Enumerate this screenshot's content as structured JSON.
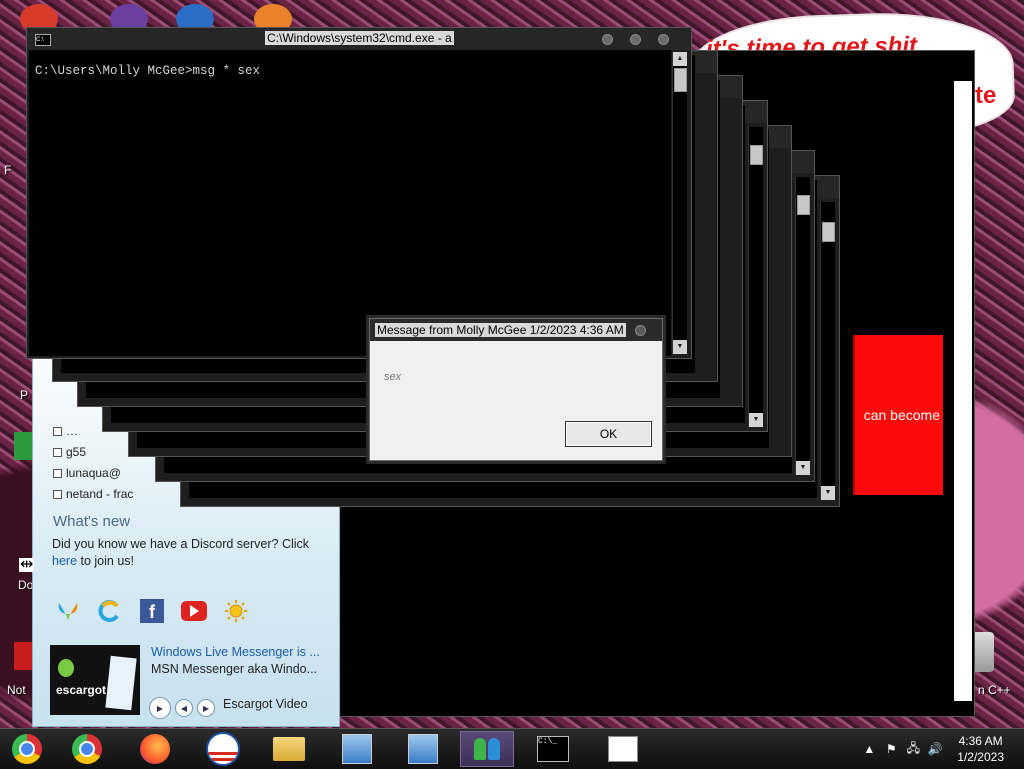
{
  "wallpaper": {
    "bubble_line1": "it's time to get shit",
    "bubble_line2": "te"
  },
  "desktop_labels": {
    "do": "Do",
    "not": "Not",
    "cpp": "n C++",
    "p": "P",
    "f": "F"
  },
  "red_panel": {
    "text": "can become"
  },
  "cmd": {
    "title": "C:\\Windows\\system32\\cmd.exe - a",
    "prompt": "C:\\Users\\Molly McGee>msg * sex"
  },
  "message_box": {
    "title": "Message from Molly McGee 1/2/2023 4:36 AM",
    "body": "sex",
    "ok": "OK"
  },
  "messenger": {
    "contacts": [
      "g55",
      "lunaqua@",
      "netand - frac"
    ],
    "whats_new_title": "What's new",
    "whats_new_text": "Did you know we have a Discord server? Click",
    "whats_new_link": "here",
    "whats_new_tail": " to join us!",
    "social_icons": [
      "messenger-butterfly-icon",
      "refresh-c-icon",
      "facebook-icon",
      "youtube-icon",
      "sun-icon"
    ],
    "video": {
      "title": "Windows Live Messenger is ...",
      "subtitle": "MSN Messenger aka Windo...",
      "thumb_label": "escargot",
      "player_label": "Escargot Video"
    }
  },
  "taskbar": {
    "apps": [
      "chrome-old-icon",
      "chrome-icon",
      "firefox-icon",
      "obama-logo-icon",
      "folder-icon",
      "network-setup-icon",
      "network-setup-icon-2",
      "messenger-people-icon",
      "cmd-icon",
      "app-window-icon"
    ],
    "clock_time": "4:36 AM",
    "clock_date": "1/2/2023"
  },
  "colors": {
    "red_panel": "#ff0a0a",
    "taskbar_active": "#5a4a78",
    "link": "#1a5aa8"
  }
}
